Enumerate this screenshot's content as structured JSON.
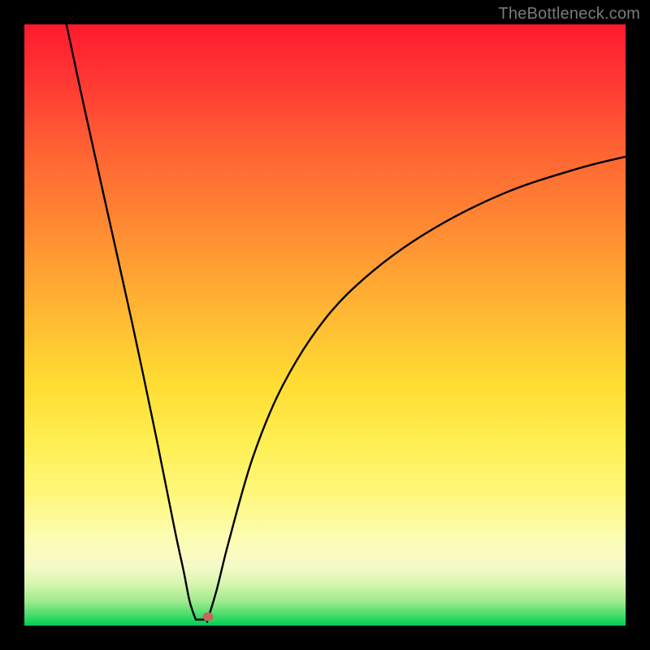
{
  "watermark": "TheBottleneck.com",
  "colors": {
    "frame": "#000000",
    "curve_stroke": "#000000",
    "marker_fill": "#c5675f"
  },
  "chart_data": {
    "type": "line",
    "title": "",
    "xlabel": "",
    "ylabel": "",
    "xlim": [
      0,
      100
    ],
    "ylim": [
      0,
      100
    ],
    "grid": false,
    "curve": {
      "name": "bottleneck-curve",
      "left_branch": {
        "x": [
          7,
          10,
          14,
          18,
          22,
          25,
          26.5,
          27.5,
          28.5
        ],
        "y": [
          100,
          86,
          68,
          50,
          31,
          16,
          9,
          4,
          1
        ]
      },
      "valley": {
        "x": [
          28.5,
          30.5
        ],
        "y": [
          1,
          1
        ]
      },
      "right_branch": {
        "x": [
          30.5,
          32,
          34,
          38,
          43,
          50,
          58,
          68,
          80,
          92,
          100
        ],
        "y": [
          1,
          6,
          14,
          28,
          40,
          51,
          59,
          66,
          72,
          76,
          78
        ]
      }
    },
    "marker": {
      "x": 30.5,
      "y": 1.5
    },
    "background_gradient": [
      {
        "pos": 0,
        "color": "#ff1a2e"
      },
      {
        "pos": 35,
        "color": "#ff8e33"
      },
      {
        "pos": 70,
        "color": "#ffef55"
      },
      {
        "pos": 96,
        "color": "#9eea8c"
      },
      {
        "pos": 100,
        "color": "#00cc55"
      }
    ]
  }
}
